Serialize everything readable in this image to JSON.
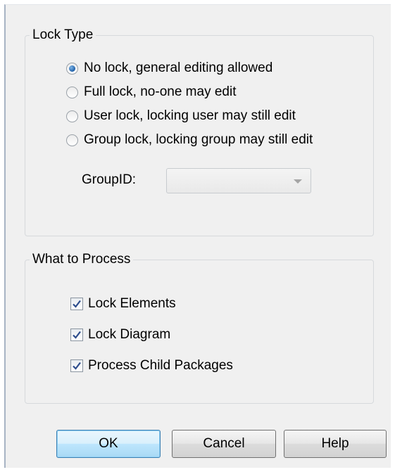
{
  "lock_type": {
    "legend": "Lock Type",
    "options": [
      {
        "label": "No lock, general editing allowed",
        "selected": true
      },
      {
        "label": "Full lock, no-one may edit",
        "selected": false
      },
      {
        "label": "User lock, locking user may still edit",
        "selected": false
      },
      {
        "label": "Group lock, locking group may still edit",
        "selected": false
      }
    ],
    "group_id_label": "GroupID:",
    "group_id_value": "",
    "group_id_enabled": false
  },
  "what_to_process": {
    "legend": "What to Process",
    "options": [
      {
        "label": "Lock Elements",
        "checked": true
      },
      {
        "label": "Lock Diagram",
        "checked": true
      },
      {
        "label": "Process Child Packages",
        "checked": true
      }
    ]
  },
  "buttons": {
    "ok": "OK",
    "cancel": "Cancel",
    "help": "Help"
  },
  "colors": {
    "dialog_background": "#f0f0f0",
    "default_button": "#bee6fd",
    "check_mark": "#2c4c8c",
    "radio_dot": "#1d5ea6"
  }
}
